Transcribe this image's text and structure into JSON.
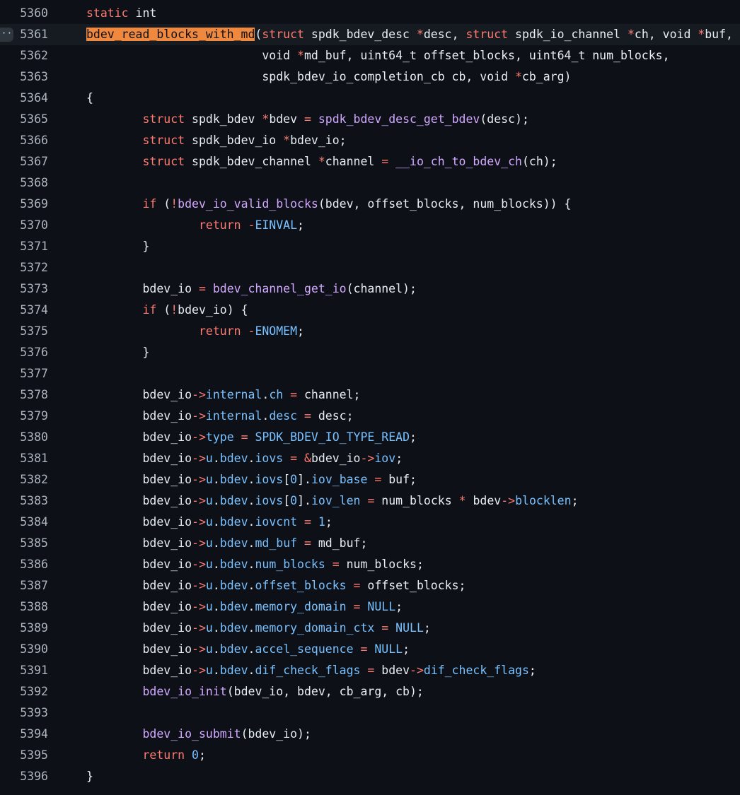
{
  "lines": [
    {
      "n": "5360",
      "tokens": [
        [
          "kw",
          "static"
        ],
        [
          "pl",
          " int"
        ]
      ]
    },
    {
      "n": "5361",
      "active": true,
      "tokens": [
        [
          "hl",
          "bdev_read_blocks_with_md"
        ],
        [
          "pl",
          "("
        ],
        [
          "kw",
          "struct"
        ],
        [
          "pl",
          " spdk_bdev_desc "
        ],
        [
          "kw",
          "*"
        ],
        [
          "pl",
          "desc, "
        ],
        [
          "kw",
          "struct"
        ],
        [
          "pl",
          " spdk_io_channel "
        ],
        [
          "kw",
          "*"
        ],
        [
          "pl",
          "ch, void "
        ],
        [
          "kw",
          "*"
        ],
        [
          "pl",
          "buf,"
        ]
      ]
    },
    {
      "n": "5362",
      "tokens": [
        [
          "pl",
          "                         void "
        ],
        [
          "kw",
          "*"
        ],
        [
          "pl",
          "md_buf, uint64_t offset_blocks, uint64_t num_blocks,"
        ]
      ]
    },
    {
      "n": "5363",
      "tokens": [
        [
          "pl",
          "                         spdk_bdev_io_completion_cb cb, void "
        ],
        [
          "kw",
          "*"
        ],
        [
          "pl",
          "cb_arg)"
        ]
      ]
    },
    {
      "n": "5364",
      "tokens": [
        [
          "pl",
          "{"
        ]
      ]
    },
    {
      "n": "5365",
      "tokens": [
        [
          "pl",
          "        "
        ],
        [
          "kw",
          "struct"
        ],
        [
          "pl",
          " spdk_bdev "
        ],
        [
          "kw",
          "*"
        ],
        [
          "pl",
          "bdev "
        ],
        [
          "kw",
          "="
        ],
        [
          "pl",
          " "
        ],
        [
          "fn",
          "spdk_bdev_desc_get_bdev"
        ],
        [
          "pl",
          "(desc);"
        ]
      ]
    },
    {
      "n": "5366",
      "tokens": [
        [
          "pl",
          "        "
        ],
        [
          "kw",
          "struct"
        ],
        [
          "pl",
          " spdk_bdev_io "
        ],
        [
          "kw",
          "*"
        ],
        [
          "pl",
          "bdev_io;"
        ]
      ]
    },
    {
      "n": "5367",
      "tokens": [
        [
          "pl",
          "        "
        ],
        [
          "kw",
          "struct"
        ],
        [
          "pl",
          " spdk_bdev_channel "
        ],
        [
          "kw",
          "*"
        ],
        [
          "pl",
          "channel "
        ],
        [
          "kw",
          "="
        ],
        [
          "pl",
          " "
        ],
        [
          "fn",
          "__io_ch_to_bdev_ch"
        ],
        [
          "pl",
          "(ch);"
        ]
      ]
    },
    {
      "n": "5368",
      "tokens": []
    },
    {
      "n": "5369",
      "tokens": [
        [
          "pl",
          "        "
        ],
        [
          "kw",
          "if"
        ],
        [
          "pl",
          " ("
        ],
        [
          "kw",
          "!"
        ],
        [
          "fn",
          "bdev_io_valid_blocks"
        ],
        [
          "pl",
          "(bdev, offset_blocks, num_blocks)) {"
        ]
      ]
    },
    {
      "n": "5370",
      "tokens": [
        [
          "pl",
          "                "
        ],
        [
          "kw",
          "return"
        ],
        [
          "pl",
          " "
        ],
        [
          "kw",
          "-"
        ],
        [
          "cn",
          "EINVAL"
        ],
        [
          "pl",
          ";"
        ]
      ]
    },
    {
      "n": "5371",
      "tokens": [
        [
          "pl",
          "        }"
        ]
      ]
    },
    {
      "n": "5372",
      "tokens": []
    },
    {
      "n": "5373",
      "tokens": [
        [
          "pl",
          "        bdev_io "
        ],
        [
          "kw",
          "="
        ],
        [
          "pl",
          " "
        ],
        [
          "fn",
          "bdev_channel_get_io"
        ],
        [
          "pl",
          "(channel);"
        ]
      ]
    },
    {
      "n": "5374",
      "tokens": [
        [
          "pl",
          "        "
        ],
        [
          "kw",
          "if"
        ],
        [
          "pl",
          " ("
        ],
        [
          "kw",
          "!"
        ],
        [
          "pl",
          "bdev_io) {"
        ]
      ]
    },
    {
      "n": "5375",
      "tokens": [
        [
          "pl",
          "                "
        ],
        [
          "kw",
          "return"
        ],
        [
          "pl",
          " "
        ],
        [
          "kw",
          "-"
        ],
        [
          "cn",
          "ENOMEM"
        ],
        [
          "pl",
          ";"
        ]
      ]
    },
    {
      "n": "5376",
      "tokens": [
        [
          "pl",
          "        }"
        ]
      ]
    },
    {
      "n": "5377",
      "tokens": []
    },
    {
      "n": "5378",
      "tokens": [
        [
          "pl",
          "        bdev_io"
        ],
        [
          "kw",
          "->"
        ],
        [
          "cn",
          "internal"
        ],
        [
          "pl",
          "."
        ],
        [
          "cn",
          "ch"
        ],
        [
          "pl",
          " "
        ],
        [
          "kw",
          "="
        ],
        [
          "pl",
          " channel;"
        ]
      ]
    },
    {
      "n": "5379",
      "tokens": [
        [
          "pl",
          "        bdev_io"
        ],
        [
          "kw",
          "->"
        ],
        [
          "cn",
          "internal"
        ],
        [
          "pl",
          "."
        ],
        [
          "cn",
          "desc"
        ],
        [
          "pl",
          " "
        ],
        [
          "kw",
          "="
        ],
        [
          "pl",
          " desc;"
        ]
      ]
    },
    {
      "n": "5380",
      "tokens": [
        [
          "pl",
          "        bdev_io"
        ],
        [
          "kw",
          "->"
        ],
        [
          "cn",
          "type"
        ],
        [
          "pl",
          " "
        ],
        [
          "kw",
          "="
        ],
        [
          "pl",
          " "
        ],
        [
          "cn",
          "SPDK_BDEV_IO_TYPE_READ"
        ],
        [
          "pl",
          ";"
        ]
      ]
    },
    {
      "n": "5381",
      "tokens": [
        [
          "pl",
          "        bdev_io"
        ],
        [
          "kw",
          "->"
        ],
        [
          "cn",
          "u"
        ],
        [
          "pl",
          "."
        ],
        [
          "cn",
          "bdev"
        ],
        [
          "pl",
          "."
        ],
        [
          "cn",
          "iovs"
        ],
        [
          "pl",
          " "
        ],
        [
          "kw",
          "="
        ],
        [
          "pl",
          " "
        ],
        [
          "kw",
          "&"
        ],
        [
          "pl",
          "bdev_io"
        ],
        [
          "kw",
          "->"
        ],
        [
          "cn",
          "iov"
        ],
        [
          "pl",
          ";"
        ]
      ]
    },
    {
      "n": "5382",
      "tokens": [
        [
          "pl",
          "        bdev_io"
        ],
        [
          "kw",
          "->"
        ],
        [
          "cn",
          "u"
        ],
        [
          "pl",
          "."
        ],
        [
          "cn",
          "bdev"
        ],
        [
          "pl",
          "."
        ],
        [
          "cn",
          "iovs"
        ],
        [
          "pl",
          "["
        ],
        [
          "cn",
          "0"
        ],
        [
          "pl",
          "]."
        ],
        [
          "cn",
          "iov_base"
        ],
        [
          "pl",
          " "
        ],
        [
          "kw",
          "="
        ],
        [
          "pl",
          " buf;"
        ]
      ]
    },
    {
      "n": "5383",
      "tokens": [
        [
          "pl",
          "        bdev_io"
        ],
        [
          "kw",
          "->"
        ],
        [
          "cn",
          "u"
        ],
        [
          "pl",
          "."
        ],
        [
          "cn",
          "bdev"
        ],
        [
          "pl",
          "."
        ],
        [
          "cn",
          "iovs"
        ],
        [
          "pl",
          "["
        ],
        [
          "cn",
          "0"
        ],
        [
          "pl",
          "]."
        ],
        [
          "cn",
          "iov_len"
        ],
        [
          "pl",
          " "
        ],
        [
          "kw",
          "="
        ],
        [
          "pl",
          " num_blocks "
        ],
        [
          "kw",
          "*"
        ],
        [
          "pl",
          " bdev"
        ],
        [
          "kw",
          "->"
        ],
        [
          "cn",
          "blocklen"
        ],
        [
          "pl",
          ";"
        ]
      ]
    },
    {
      "n": "5384",
      "tokens": [
        [
          "pl",
          "        bdev_io"
        ],
        [
          "kw",
          "->"
        ],
        [
          "cn",
          "u"
        ],
        [
          "pl",
          "."
        ],
        [
          "cn",
          "bdev"
        ],
        [
          "pl",
          "."
        ],
        [
          "cn",
          "iovcnt"
        ],
        [
          "pl",
          " "
        ],
        [
          "kw",
          "="
        ],
        [
          "pl",
          " "
        ],
        [
          "cn",
          "1"
        ],
        [
          "pl",
          ";"
        ]
      ]
    },
    {
      "n": "5385",
      "tokens": [
        [
          "pl",
          "        bdev_io"
        ],
        [
          "kw",
          "->"
        ],
        [
          "cn",
          "u"
        ],
        [
          "pl",
          "."
        ],
        [
          "cn",
          "bdev"
        ],
        [
          "pl",
          "."
        ],
        [
          "cn",
          "md_buf"
        ],
        [
          "pl",
          " "
        ],
        [
          "kw",
          "="
        ],
        [
          "pl",
          " md_buf;"
        ]
      ]
    },
    {
      "n": "5386",
      "tokens": [
        [
          "pl",
          "        bdev_io"
        ],
        [
          "kw",
          "->"
        ],
        [
          "cn",
          "u"
        ],
        [
          "pl",
          "."
        ],
        [
          "cn",
          "bdev"
        ],
        [
          "pl",
          "."
        ],
        [
          "cn",
          "num_blocks"
        ],
        [
          "pl",
          " "
        ],
        [
          "kw",
          "="
        ],
        [
          "pl",
          " num_blocks;"
        ]
      ]
    },
    {
      "n": "5387",
      "tokens": [
        [
          "pl",
          "        bdev_io"
        ],
        [
          "kw",
          "->"
        ],
        [
          "cn",
          "u"
        ],
        [
          "pl",
          "."
        ],
        [
          "cn",
          "bdev"
        ],
        [
          "pl",
          "."
        ],
        [
          "cn",
          "offset_blocks"
        ],
        [
          "pl",
          " "
        ],
        [
          "kw",
          "="
        ],
        [
          "pl",
          " offset_blocks;"
        ]
      ]
    },
    {
      "n": "5388",
      "tokens": [
        [
          "pl",
          "        bdev_io"
        ],
        [
          "kw",
          "->"
        ],
        [
          "cn",
          "u"
        ],
        [
          "pl",
          "."
        ],
        [
          "cn",
          "bdev"
        ],
        [
          "pl",
          "."
        ],
        [
          "cn",
          "memory_domain"
        ],
        [
          "pl",
          " "
        ],
        [
          "kw",
          "="
        ],
        [
          "pl",
          " "
        ],
        [
          "cn",
          "NULL"
        ],
        [
          "pl",
          ";"
        ]
      ]
    },
    {
      "n": "5389",
      "tokens": [
        [
          "pl",
          "        bdev_io"
        ],
        [
          "kw",
          "->"
        ],
        [
          "cn",
          "u"
        ],
        [
          "pl",
          "."
        ],
        [
          "cn",
          "bdev"
        ],
        [
          "pl",
          "."
        ],
        [
          "cn",
          "memory_domain_ctx"
        ],
        [
          "pl",
          " "
        ],
        [
          "kw",
          "="
        ],
        [
          "pl",
          " "
        ],
        [
          "cn",
          "NULL"
        ],
        [
          "pl",
          ";"
        ]
      ]
    },
    {
      "n": "5390",
      "tokens": [
        [
          "pl",
          "        bdev_io"
        ],
        [
          "kw",
          "->"
        ],
        [
          "cn",
          "u"
        ],
        [
          "pl",
          "."
        ],
        [
          "cn",
          "bdev"
        ],
        [
          "pl",
          "."
        ],
        [
          "cn",
          "accel_sequence"
        ],
        [
          "pl",
          " "
        ],
        [
          "kw",
          "="
        ],
        [
          "pl",
          " "
        ],
        [
          "cn",
          "NULL"
        ],
        [
          "pl",
          ";"
        ]
      ]
    },
    {
      "n": "5391",
      "tokens": [
        [
          "pl",
          "        bdev_io"
        ],
        [
          "kw",
          "->"
        ],
        [
          "cn",
          "u"
        ],
        [
          "pl",
          "."
        ],
        [
          "cn",
          "bdev"
        ],
        [
          "pl",
          "."
        ],
        [
          "cn",
          "dif_check_flags"
        ],
        [
          "pl",
          " "
        ],
        [
          "kw",
          "="
        ],
        [
          "pl",
          " bdev"
        ],
        [
          "kw",
          "->"
        ],
        [
          "cn",
          "dif_check_flags"
        ],
        [
          "pl",
          ";"
        ]
      ]
    },
    {
      "n": "5392",
      "tokens": [
        [
          "pl",
          "        "
        ],
        [
          "fn",
          "bdev_io_init"
        ],
        [
          "pl",
          "(bdev_io, bdev, cb_arg, cb);"
        ]
      ]
    },
    {
      "n": "5393",
      "tokens": []
    },
    {
      "n": "5394",
      "tokens": [
        [
          "pl",
          "        "
        ],
        [
          "fn",
          "bdev_io_submit"
        ],
        [
          "pl",
          "(bdev_io);"
        ]
      ]
    },
    {
      "n": "5395",
      "tokens": [
        [
          "pl",
          "        "
        ],
        [
          "kw",
          "return"
        ],
        [
          "pl",
          " "
        ],
        [
          "cn",
          "0"
        ],
        [
          "pl",
          ";"
        ]
      ]
    },
    {
      "n": "5396",
      "tokens": [
        [
          "pl",
          "}"
        ]
      ]
    }
  ],
  "gutter_button": {
    "label": "··",
    "icon": "kebab-horizontal-icon"
  },
  "colors": {
    "background": "#0d1117",
    "keyword": "#ff7b72",
    "function": "#d2a8ff",
    "constant": "#79c0ff",
    "plain": "#e6edf3",
    "highlight": "#f0883e"
  }
}
